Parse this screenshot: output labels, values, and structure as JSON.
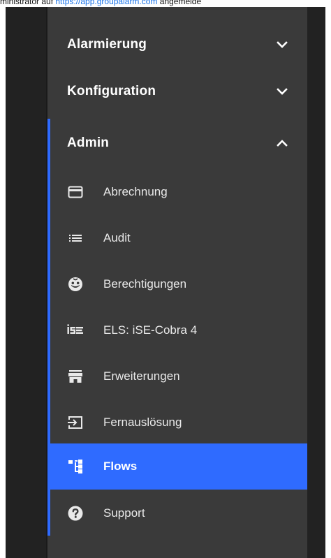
{
  "topline": {
    "lead_text": "ministrator auf ",
    "link_text": "https://app.groupalarm.com",
    "tail_text": " angemelde"
  },
  "colors": {
    "menu_bg": "#3a3a3a",
    "frame_bg": "#222222",
    "accent": "#2f6bff",
    "text": "#e9e9e9"
  },
  "sections": [
    {
      "label": "Alarmierung",
      "state": "collapsed",
      "icon": "chevron-down-icon"
    },
    {
      "label": "Konfiguration",
      "state": "collapsed",
      "icon": "chevron-down-icon"
    },
    {
      "label": "Admin",
      "state": "expanded",
      "icon": "chevron-up-icon"
    }
  ],
  "admin_items": [
    {
      "label": "Abrechnung",
      "icon": "credit-card-icon"
    },
    {
      "label": "Audit",
      "icon": "list-icon"
    },
    {
      "label": "Berechtigungen",
      "icon": "emoji-face-icon"
    },
    {
      "label": "ELS: iSE-Cobra 4",
      "icon": "ise-logo-icon"
    },
    {
      "label": "Erweiterungen",
      "icon": "storefront-icon"
    },
    {
      "label": "Fernauslösung",
      "icon": "input-arrow-icon"
    },
    {
      "label": "Flows",
      "icon": "flow-tree-icon",
      "active": true
    },
    {
      "label": "Support",
      "icon": "help-circle-icon"
    }
  ]
}
